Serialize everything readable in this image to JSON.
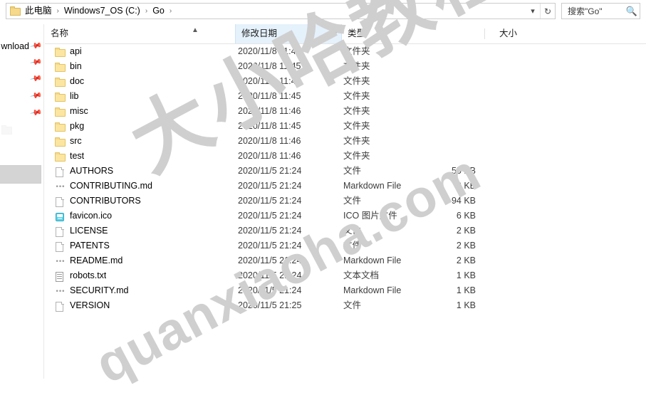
{
  "addressbar": {
    "folder_icon": "folder-icon",
    "crumbs": [
      "此电脑",
      "Windows7_OS (C:)",
      "Go"
    ],
    "separator": "›",
    "history_dropdown_icon": "chevron-down-icon",
    "refresh_icon": "refresh-icon"
  },
  "search": {
    "value": "搜索\"Go\"",
    "icon": "search-icon"
  },
  "sidebar": {
    "items": [
      {
        "label": "wnload",
        "pin_icon": "pin-icon"
      },
      {
        "label": "",
        "pin_icon": "pin-icon"
      },
      {
        "label": "",
        "pin_icon": "pin-icon"
      },
      {
        "label": "",
        "pin_icon": "pin-icon"
      },
      {
        "label": "",
        "pin_icon": "pin-icon"
      }
    ]
  },
  "columns": {
    "name": "名称",
    "date": "修改日期",
    "type": "类型",
    "size": "大小",
    "sort_arrow_icon": "sort-ascending-icon",
    "date_chevron_icon": "chevron-down-icon"
  },
  "files": [
    {
      "icon": "folder-icon",
      "name": "api",
      "date": "2020/11/8 11:46",
      "type": "文件夹",
      "size": ""
    },
    {
      "icon": "folder-icon",
      "name": "bin",
      "date": "2020/11/8 11:45",
      "type": "文件夹",
      "size": ""
    },
    {
      "icon": "folder-icon",
      "name": "doc",
      "date": "2020/11/8 11:46",
      "type": "文件夹",
      "size": ""
    },
    {
      "icon": "folder-icon",
      "name": "lib",
      "date": "2020/11/8 11:45",
      "type": "文件夹",
      "size": ""
    },
    {
      "icon": "folder-icon",
      "name": "misc",
      "date": "2020/11/8 11:46",
      "type": "文件夹",
      "size": ""
    },
    {
      "icon": "folder-icon",
      "name": "pkg",
      "date": "2020/11/8 11:45",
      "type": "文件夹",
      "size": ""
    },
    {
      "icon": "folder-icon",
      "name": "src",
      "date": "2020/11/8 11:46",
      "type": "文件夹",
      "size": ""
    },
    {
      "icon": "folder-icon",
      "name": "test",
      "date": "2020/11/8 11:46",
      "type": "文件夹",
      "size": ""
    },
    {
      "icon": "document-icon",
      "name": "AUTHORS",
      "date": "2020/11/5 21:24",
      "type": "文件",
      "size": "55 KB"
    },
    {
      "icon": "markdown-icon",
      "name": "CONTRIBUTING.md",
      "date": "2020/11/5 21:24",
      "type": "Markdown File",
      "size": "2 KB"
    },
    {
      "icon": "document-icon",
      "name": "CONTRIBUTORS",
      "date": "2020/11/5 21:24",
      "type": "文件",
      "size": "94 KB"
    },
    {
      "icon": "ico-image-icon",
      "name": "favicon.ico",
      "date": "2020/11/5 21:24",
      "type": "ICO 图片文件",
      "size": "6 KB"
    },
    {
      "icon": "document-icon",
      "name": "LICENSE",
      "date": "2020/11/5 21:24",
      "type": "文件",
      "size": "2 KB"
    },
    {
      "icon": "document-icon",
      "name": "PATENTS",
      "date": "2020/11/5 21:24",
      "type": "文件",
      "size": "2 KB"
    },
    {
      "icon": "markdown-icon",
      "name": "README.md",
      "date": "2020/11/5 21:24",
      "type": "Markdown File",
      "size": "2 KB"
    },
    {
      "icon": "text-file-icon",
      "name": "robots.txt",
      "date": "2020/11/5 21:24",
      "type": "文本文档",
      "size": "1 KB"
    },
    {
      "icon": "markdown-icon",
      "name": "SECURITY.md",
      "date": "2020/11/5 21:24",
      "type": "Markdown File",
      "size": "1 KB"
    },
    {
      "icon": "document-icon",
      "name": "VERSION",
      "date": "2020/11/5 21:25",
      "type": "文件",
      "size": "1 KB"
    }
  ],
  "watermark": {
    "chinese": "大小哈教程",
    "url": "quanxiaoha.com"
  },
  "colors": {
    "header_hot": "#e5f1fb",
    "folder": "#fbe5a0",
    "selection": "#d4d4d4",
    "watermark": "#cfcfcf"
  }
}
